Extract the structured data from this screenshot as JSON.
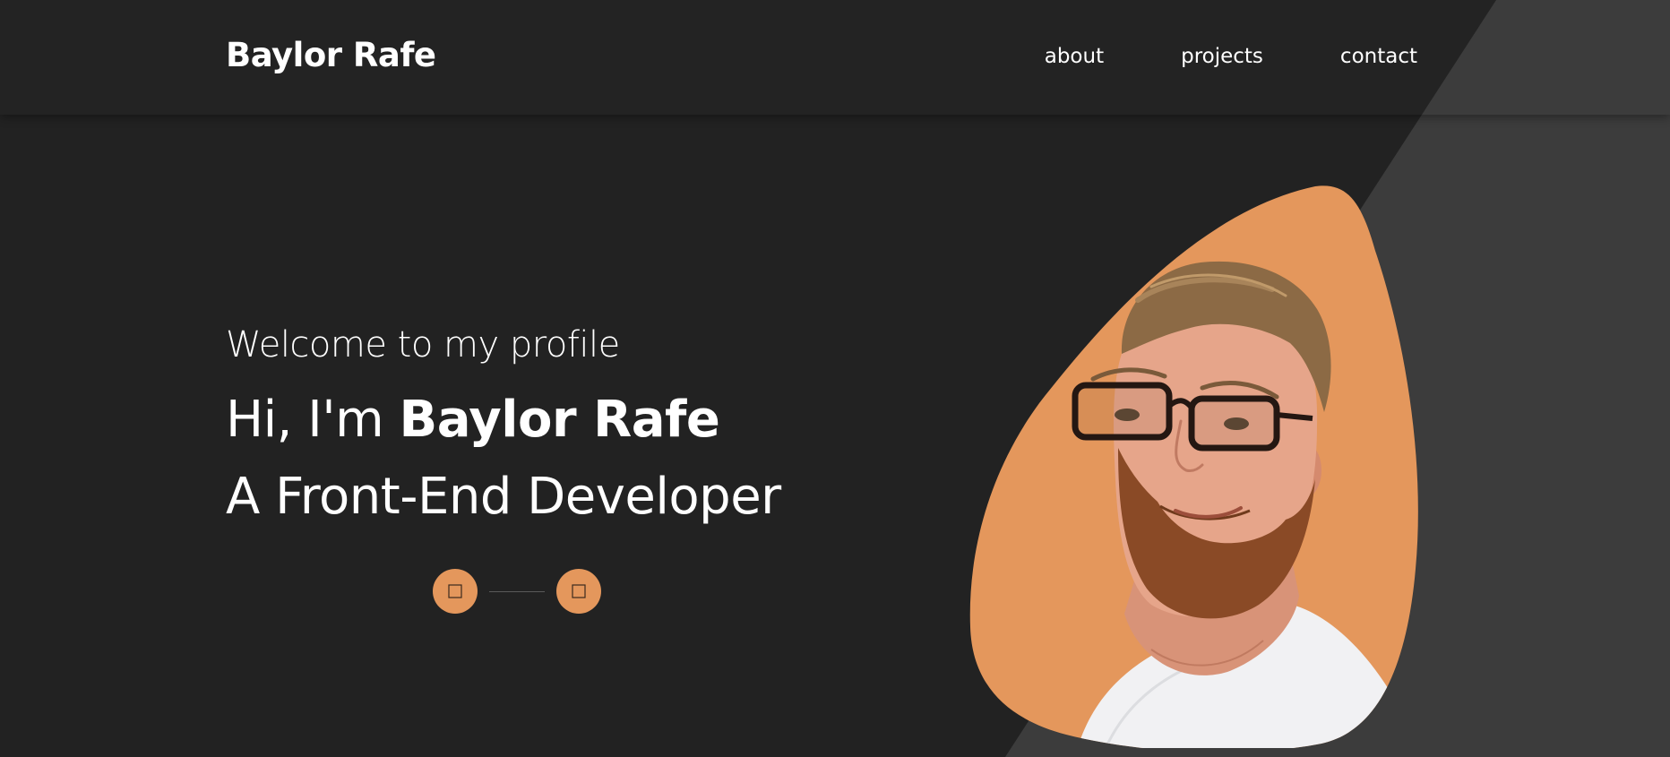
{
  "brand": {
    "name": "Baylor Rafe"
  },
  "nav": {
    "items": [
      {
        "label": "about"
      },
      {
        "label": "projects"
      },
      {
        "label": "contact"
      }
    ]
  },
  "hero": {
    "welcome": "Welcome to my profile",
    "greeting_prefix": "Hi, I'm ",
    "greeting_name": "Baylor Rafe",
    "role": "A Front-End Developer"
  },
  "socials": [
    {
      "icon": "github-icon"
    },
    {
      "icon": "linkedin-icon"
    }
  ],
  "portrait": {
    "icon": "profile-portrait"
  },
  "colors": {
    "background": "#222222",
    "background_accent": "#3c3c3c",
    "navbar": "#232323",
    "accent": "#e4975c",
    "text": "#ffffff"
  }
}
